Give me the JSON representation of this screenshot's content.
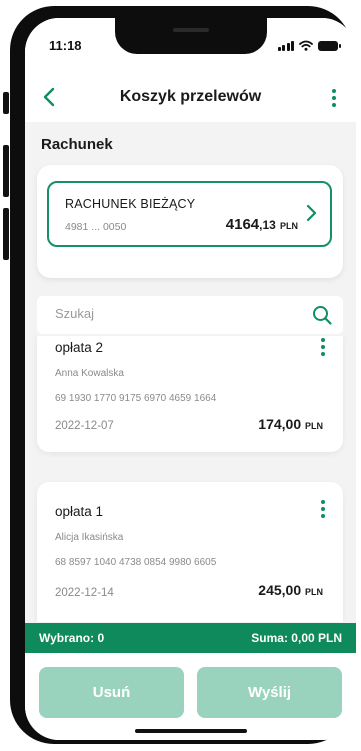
{
  "status_bar": {
    "time": "11:18"
  },
  "header": {
    "title": "Koszyk przelewów"
  },
  "account_section": {
    "label": "Rachunek",
    "account": {
      "name": "RACHUNEK BIEŻĄCY",
      "number": "4981 ... 0050",
      "balance_int": "4164",
      "balance_dec": ",13",
      "currency": "PLN"
    }
  },
  "search": {
    "placeholder": "Szukaj",
    "value": ""
  },
  "transfers": [
    {
      "title": "opłata 2",
      "recipient": "Anna Kowalska",
      "account": "69 1930 1770 9175 6970 4659 1664",
      "date": "2022-12-07",
      "amount": "174,00",
      "currency": "PLN"
    },
    {
      "title": "opłata 1",
      "recipient": "Alicja Ikasińska",
      "account": "68 8597 1040 4738 0854 9980 6605",
      "date": "2022-12-14",
      "amount": "245,00",
      "currency": "PLN"
    }
  ],
  "summary": {
    "selected": "Wybrano: 0",
    "total": "Suma: 0,00 PLN"
  },
  "actions": {
    "delete_label": "Usuń",
    "send_label": "Wyślij"
  },
  "icons": {
    "back": "chevron-left-icon",
    "menu": "more-vertical-icon",
    "account_arrow": "chevron-right-icon",
    "search": "search-icon"
  },
  "colors": {
    "accent": "#0e8f5f",
    "summary_bar": "#0f8a5c",
    "button_disabled": "#9ad3bd"
  }
}
